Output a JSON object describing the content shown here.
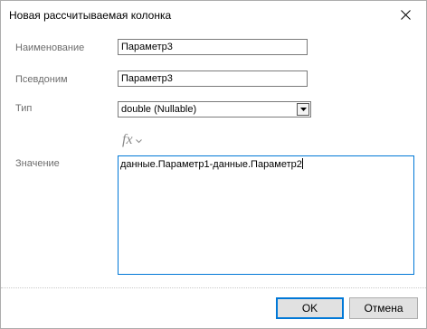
{
  "window": {
    "title": "Новая рассчитываемая колонка"
  },
  "form": {
    "name_label": "Наименование",
    "name_value": "Параметр3",
    "alias_label": "Псевдоним",
    "alias_value": "Параметр3",
    "type_label": "Тип",
    "type_value": "double (Nullable)",
    "value_label": "Значение",
    "value_text": "данные.Параметр1-данные.Параметр2"
  },
  "icons": {
    "close": "close-icon",
    "combo_arrow": "triangle-down-icon",
    "formula": "fx-icon",
    "chevron": "chevron-down-icon"
  },
  "buttons": {
    "ok_label": "OK",
    "cancel_label": "Отмена"
  },
  "colors": {
    "accent": "#0078d7",
    "label": "#6d6d6d",
    "button_face": "#e1e1e1"
  }
}
